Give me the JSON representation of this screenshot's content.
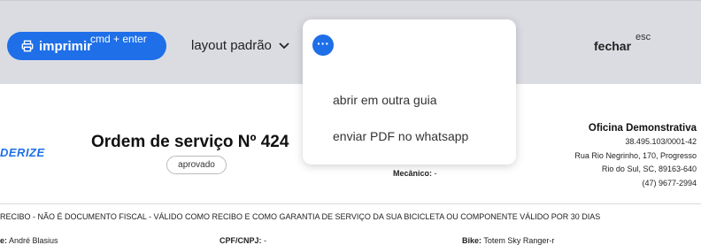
{
  "toolbar": {
    "print_label": "imprimir",
    "print_shortcut": "cmd + enter",
    "layout_label": "layout padrão",
    "close_label": "fechar",
    "close_shortcut": "esc"
  },
  "more_menu": {
    "items": [
      "abrir em outra guia",
      "enviar PDF no whatsapp"
    ]
  },
  "document": {
    "brand_fragment": "DERIZE",
    "title": "Ordem de serviço Nº 424",
    "status": "aprovado",
    "mechanic_label": "Mecânico:",
    "mechanic_value": "-",
    "company": {
      "name": "Oficina Demonstrativa",
      "cnpj": "38.495.103/0001-42",
      "address": "Rua Rio Negrinho, 170, Progresso",
      "city": "Rio do Sul, SC, 89163-640",
      "phone": "(47) 9677-2994"
    },
    "receipt_note": "RECIBO - NÃO É DOCUMENTO FISCAL - VÁLIDO COMO RECIBO E COMO GARANTIA DE SERVIÇO DA SUA BICICLETA OU COMPONENTE VÁLIDO POR 30 DIAS",
    "client_label": "e:",
    "client_value": "André Blasius",
    "cpf_label": "CPF/CNPJ:",
    "cpf_value": "-",
    "bike_label": "Bike:",
    "bike_value": "Totem Sky Ranger-r"
  }
}
